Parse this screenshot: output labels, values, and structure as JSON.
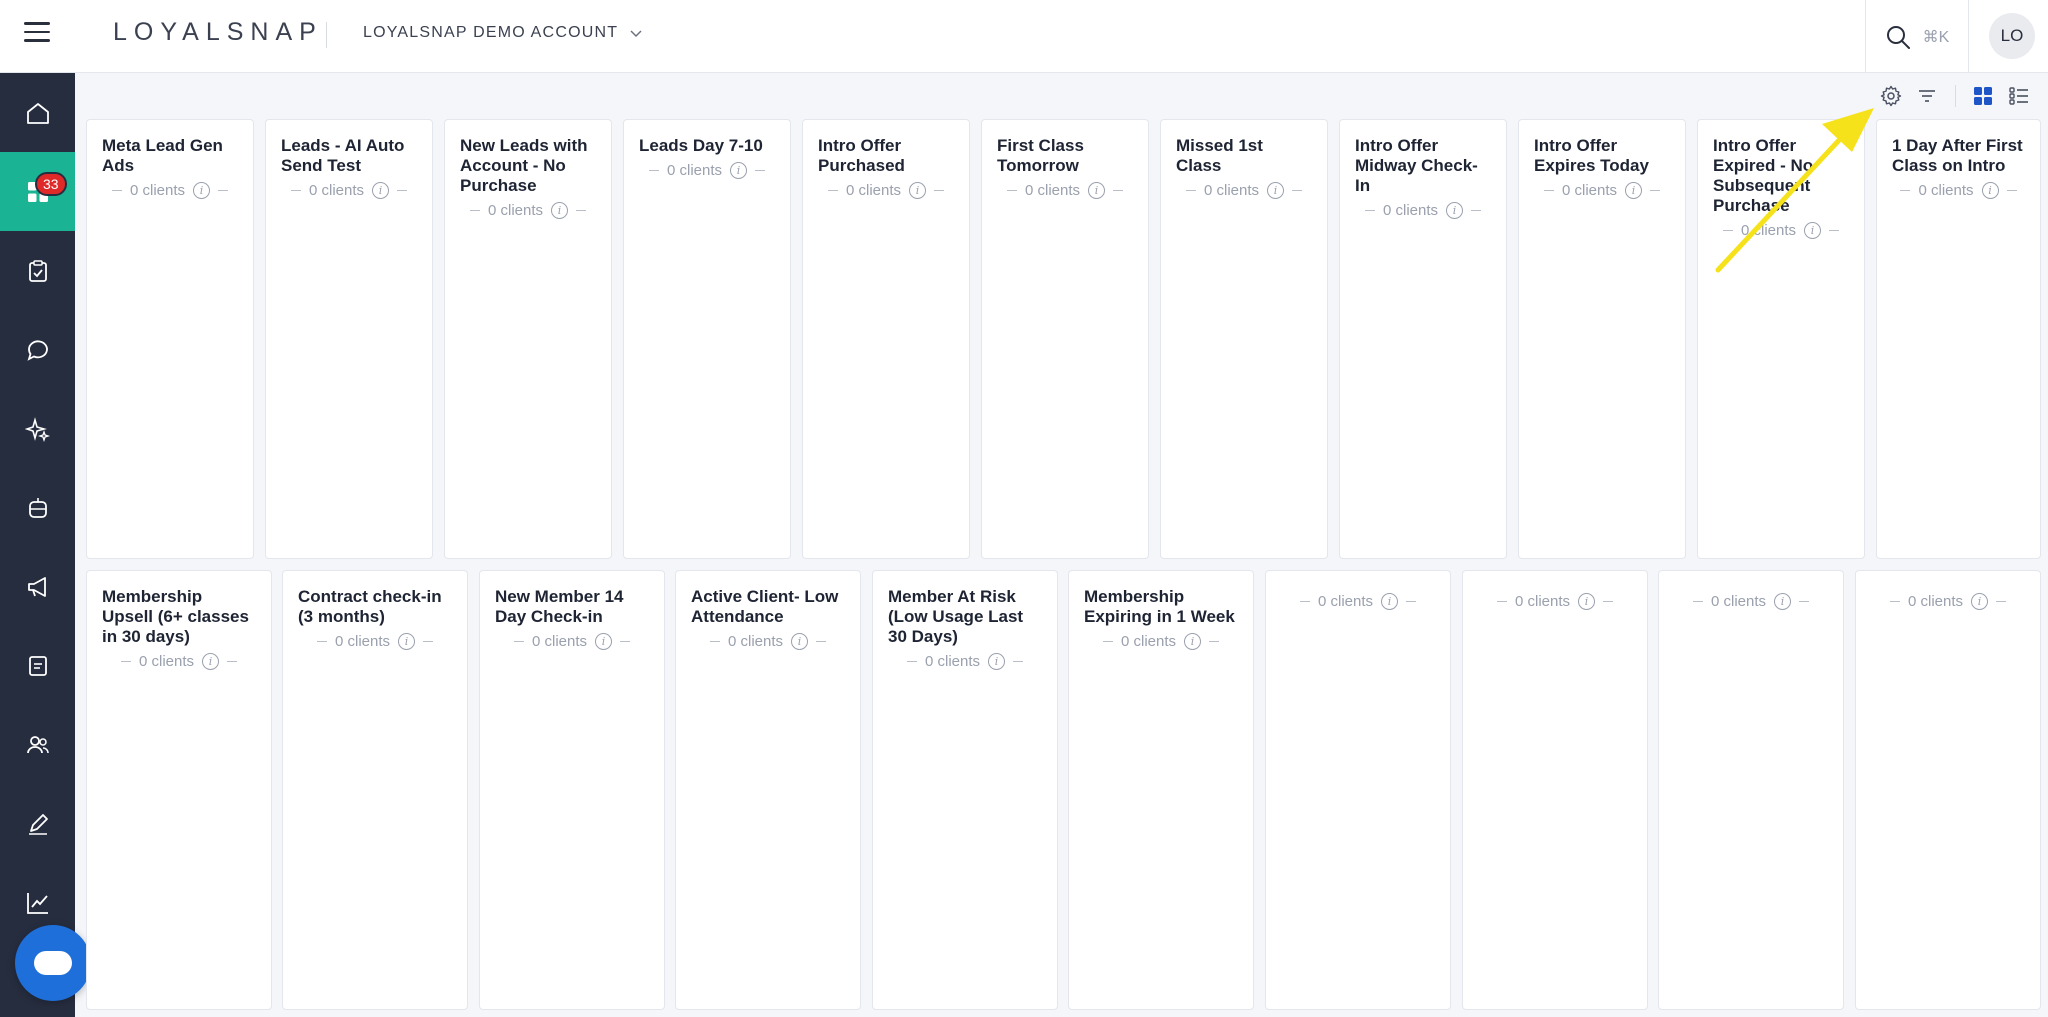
{
  "header": {
    "logo": "LOYALSNAP",
    "account": "LOYALSNAP DEMO ACCOUNT",
    "search_shortcut": "⌘K",
    "avatar_initials": "LO"
  },
  "sidebar": {
    "items": [
      {
        "name": "home-icon"
      },
      {
        "name": "dashboard-grid-icon",
        "active": true
      },
      {
        "name": "tasks-icon",
        "badge": "33"
      },
      {
        "name": "chat-icon"
      },
      {
        "name": "sparkles-icon"
      },
      {
        "name": "robot-icon"
      },
      {
        "name": "megaphone-icon"
      },
      {
        "name": "document-icon"
      },
      {
        "name": "users-icon"
      },
      {
        "name": "pen-icon"
      },
      {
        "name": "analytics-icon"
      }
    ]
  },
  "toolbar": {
    "icons": [
      "settings-icon",
      "filter-icon",
      "grid-view-icon",
      "list-view-icon"
    ]
  },
  "colors": {
    "sidebar_bg": "#262d3f",
    "active_nav": "#1ab394",
    "accent_blue": "#1e6fd9",
    "badge_red": "#e02a2a",
    "arrow_yellow": "#f5e21b"
  },
  "row1": [
    {
      "title": "Meta Lead Gen Ads",
      "count": "0 clients"
    },
    {
      "title": "Leads - AI Auto Send Test",
      "count": "0 clients"
    },
    {
      "title": "New Leads with Account - No Purchase",
      "count": "0 clients"
    },
    {
      "title": "Leads Day 7-10",
      "count": "0 clients"
    },
    {
      "title": "Intro Offer Purchased",
      "count": "0 clients"
    },
    {
      "title": "First Class Tomorrow",
      "count": "0 clients"
    },
    {
      "title": "Missed 1st Class",
      "count": "0 clients"
    },
    {
      "title": "Intro Offer Midway Check-In",
      "count": "0 clients"
    },
    {
      "title": "Intro Offer Expires Today",
      "count": "0 clients"
    },
    {
      "title": "Intro Offer Expired - No Subsequent Purchase",
      "count": "0 clients"
    },
    {
      "title": "1 Day After First Class on Intro",
      "count": "0 clients"
    }
  ],
  "row2": [
    {
      "title": "Membership Upsell (6+ classes in 30 days)",
      "count": "0 clients"
    },
    {
      "title": "Contract check-in (3 months)",
      "count": "0 clients"
    },
    {
      "title": "New Member 14 Day Check-in",
      "count": "0 clients"
    },
    {
      "title": "Active Client- Low Attendance",
      "count": "0 clients"
    },
    {
      "title": "Member At Risk (Low Usage Last 30 Days)",
      "count": "0 clients"
    },
    {
      "title": "Membership Expiring in 1 Week",
      "count": "0 clients"
    },
    {
      "title": "",
      "count": "0 clients"
    },
    {
      "title": "",
      "count": "0 clients"
    },
    {
      "title": "",
      "count": "0 clients"
    },
    {
      "title": "",
      "count": "0 clients"
    }
  ]
}
